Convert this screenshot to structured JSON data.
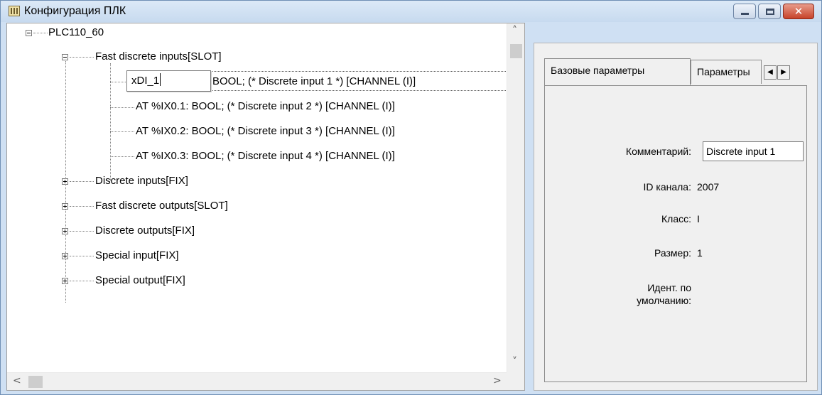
{
  "window": {
    "title": "Конфигурация ПЛК",
    "icon": "plc-config-icon",
    "close_glyph": "✕"
  },
  "tree": {
    "root": "PLC110_60",
    "slot_group": "Fast discrete inputs[SLOT]",
    "channels": [
      "BOOL; (* Discrete input 1 *) [CHANNEL (I)]",
      "AT %IX0.1: BOOL; (* Discrete input 2 *) [CHANNEL (I)]",
      "AT %IX0.2: BOOL; (* Discrete input 3 *) [CHANNEL (I)]",
      "AT %IX0.3: BOOL; (* Discrete input 4 *) [CHANNEL (I)]"
    ],
    "editing_value": "xDI_1",
    "groups": [
      "Discrete inputs[FIX]",
      "Fast discrete outputs[SLOT]",
      "Discrete outputs[FIX]",
      "Special input[FIX]",
      "Special output[FIX]"
    ]
  },
  "scroll": {
    "up": "˄",
    "down": "˅",
    "left": "<",
    "right": ">"
  },
  "properties": {
    "tabs": [
      "Базовые параметры",
      "Параметры"
    ],
    "tab_prev": "◀",
    "tab_next": "▶",
    "comment_label": "Комментарий:",
    "comment_value": "Discrete input 1",
    "channel_id_label": "ID канала:",
    "channel_id_value": "2007",
    "class_label": "Класс:",
    "class_value": "I",
    "size_label": "Размер:",
    "size_value": "1",
    "default_id_label_line1": "Идент. по",
    "default_id_label_line2": "умолчанию:"
  }
}
